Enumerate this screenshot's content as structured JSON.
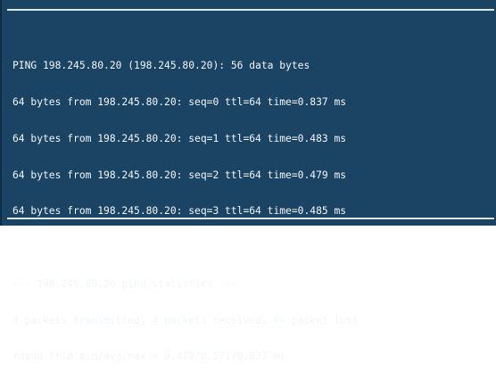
{
  "terminal": {
    "ping_header": "PING 198.245.80.20 (198.245.80.20): 56 data bytes",
    "replies": [
      "64 bytes from 198.245.80.20: seq=0 ttl=64 time=0.837 ms",
      "64 bytes from 198.245.80.20: seq=1 ttl=64 time=0.483 ms",
      "64 bytes from 198.245.80.20: seq=2 ttl=64 time=0.479 ms",
      "64 bytes from 198.245.80.20: seq=3 ttl=64 time=0.485 ms"
    ],
    "stats_header": "--- 198.245.80.20 ping statistics ---",
    "packets_summary": "4 packets transmitted, 4 packets received, 0% packet loss",
    "round_trip": "round-trip min/avg/max = 0.479/0.571/0.837 ms"
  },
  "colors": {
    "background": "#1b4364",
    "text": "#f2f6fa",
    "rule": "#dfe7ee"
  }
}
